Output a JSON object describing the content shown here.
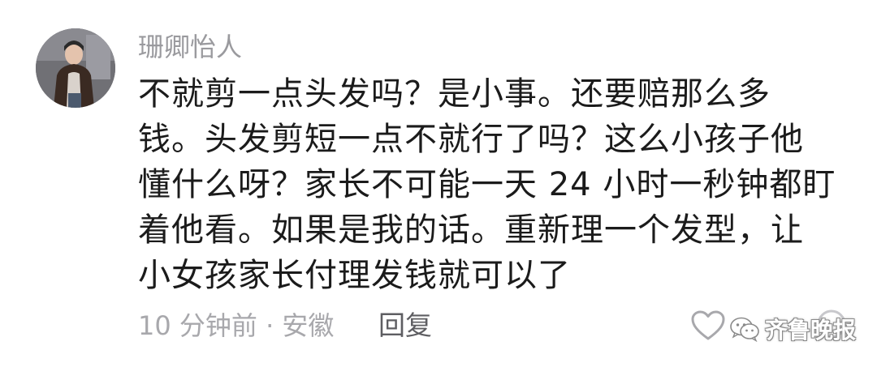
{
  "comment": {
    "username": "珊卿怡人",
    "body_lines": [
      "不就剪一点头发吗？是小事。还要赔那么多",
      "钱。头发剪短一点不就行了吗？这么小孩子他",
      "懂什么呀？家长不可能一天 24 小时一秒钟都盯",
      "着他看。如果是我的话。重新理一个发型，让",
      "小女孩家长付理发钱就可以了"
    ],
    "meta": "10 分钟前 · 安徽",
    "reply_label": "回复"
  },
  "watermark": {
    "text": "齐鲁晚报"
  },
  "icons": {
    "like": "heart-outline-icon",
    "wechat": "wechat-icon"
  },
  "colors": {
    "username": "#9a9a9e",
    "body": "#1b1b1b",
    "meta": "#a8a8ac",
    "reply": "#5e5e62"
  }
}
